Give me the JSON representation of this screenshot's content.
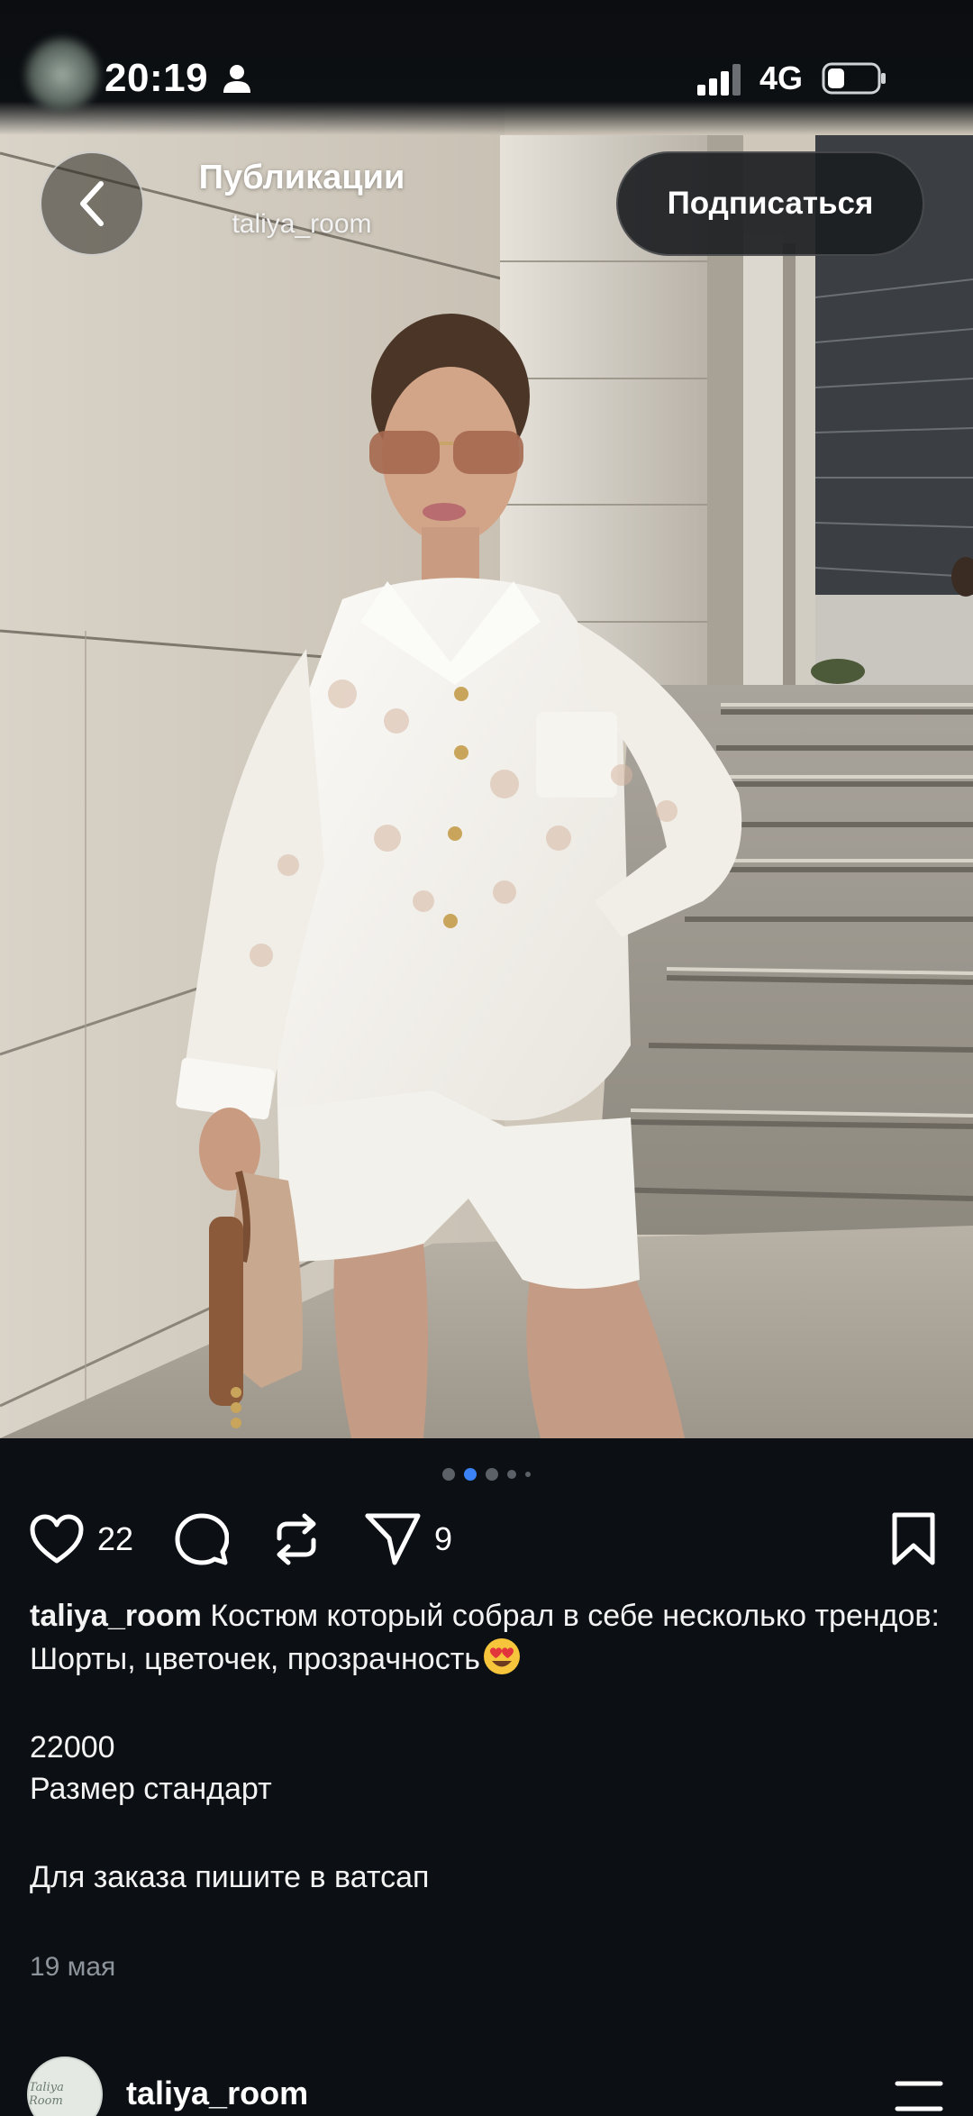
{
  "status_bar": {
    "time": "20:19",
    "network": "4G"
  },
  "header": {
    "title": "Публикации",
    "subtitle": "taliya_room",
    "follow_label": "Подписаться"
  },
  "carousel": {
    "total_dots": 5,
    "active_index": 1
  },
  "actions": {
    "likes": "22",
    "shares": "9"
  },
  "caption": {
    "username": "taliya_room",
    "line1": "Костюм который собрал в себе несколько трендов:",
    "line2": "Шорты, цветочек, прозрачность",
    "price": "22000",
    "size": "Размер стандарт",
    "order": "Для заказа пишите в ватсап"
  },
  "post_date": "19 мая",
  "next_post": {
    "username": "taliya_room",
    "avatar_text": "Taliya Room"
  },
  "colors": {
    "background": "#0c1014",
    "accent_dot": "#3b82f6",
    "muted_text": "#8e949b"
  }
}
